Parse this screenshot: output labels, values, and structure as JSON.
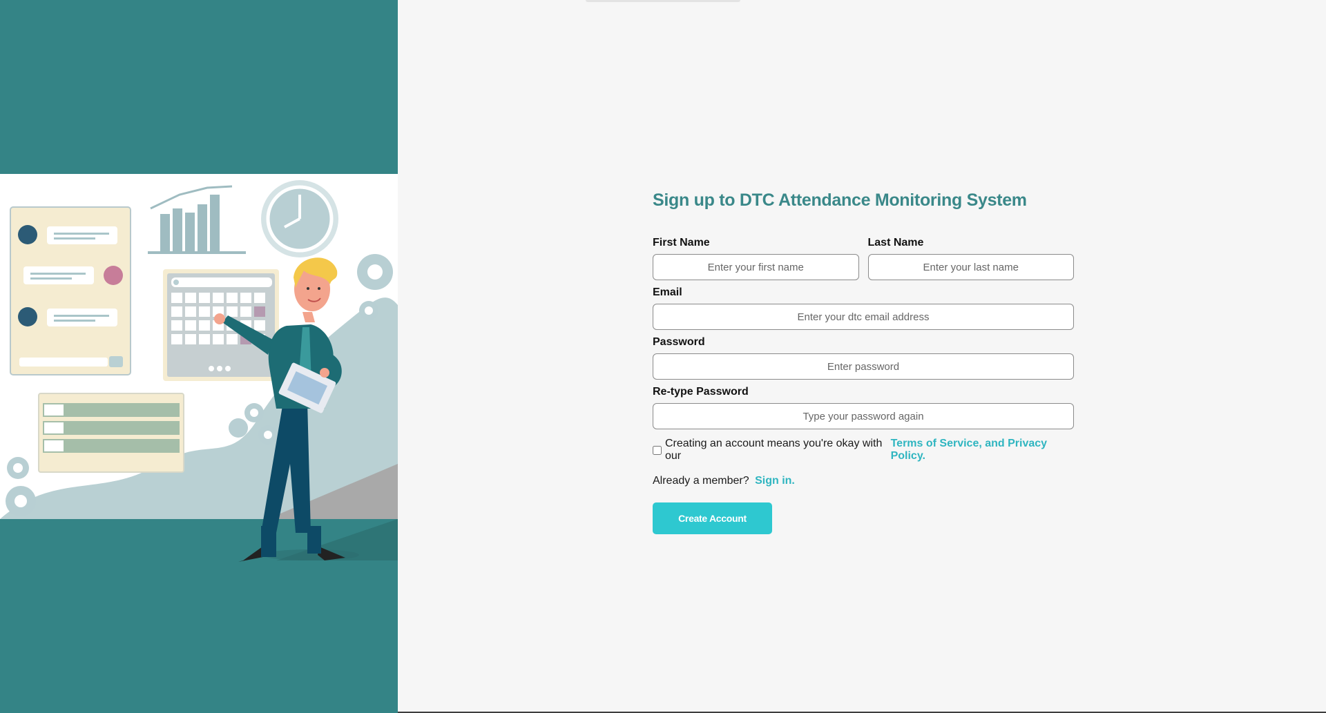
{
  "form": {
    "title": "Sign up to DTC Attendance Monitoring System",
    "first_name": {
      "label": "First Name",
      "placeholder": "Enter your first name"
    },
    "last_name": {
      "label": "Last Name",
      "placeholder": "Enter your last name"
    },
    "email": {
      "label": "Email",
      "placeholder": "Enter your dtc email address"
    },
    "password": {
      "label": "Password",
      "placeholder": "Enter password"
    },
    "retype_password": {
      "label": "Re-type Password",
      "placeholder": "Type your password again"
    },
    "terms_text": "Creating an account means you're okay with our",
    "terms_link": "Terms of Service, and Privacy Policy.",
    "member_text": "Already a member?",
    "signin_link": "Sign in.",
    "create_button": "Create Account"
  },
  "colors": {
    "left_panel": "#348486",
    "title": "#3a8889",
    "link": "#2fb5c0",
    "button": "#2ec8d0"
  }
}
